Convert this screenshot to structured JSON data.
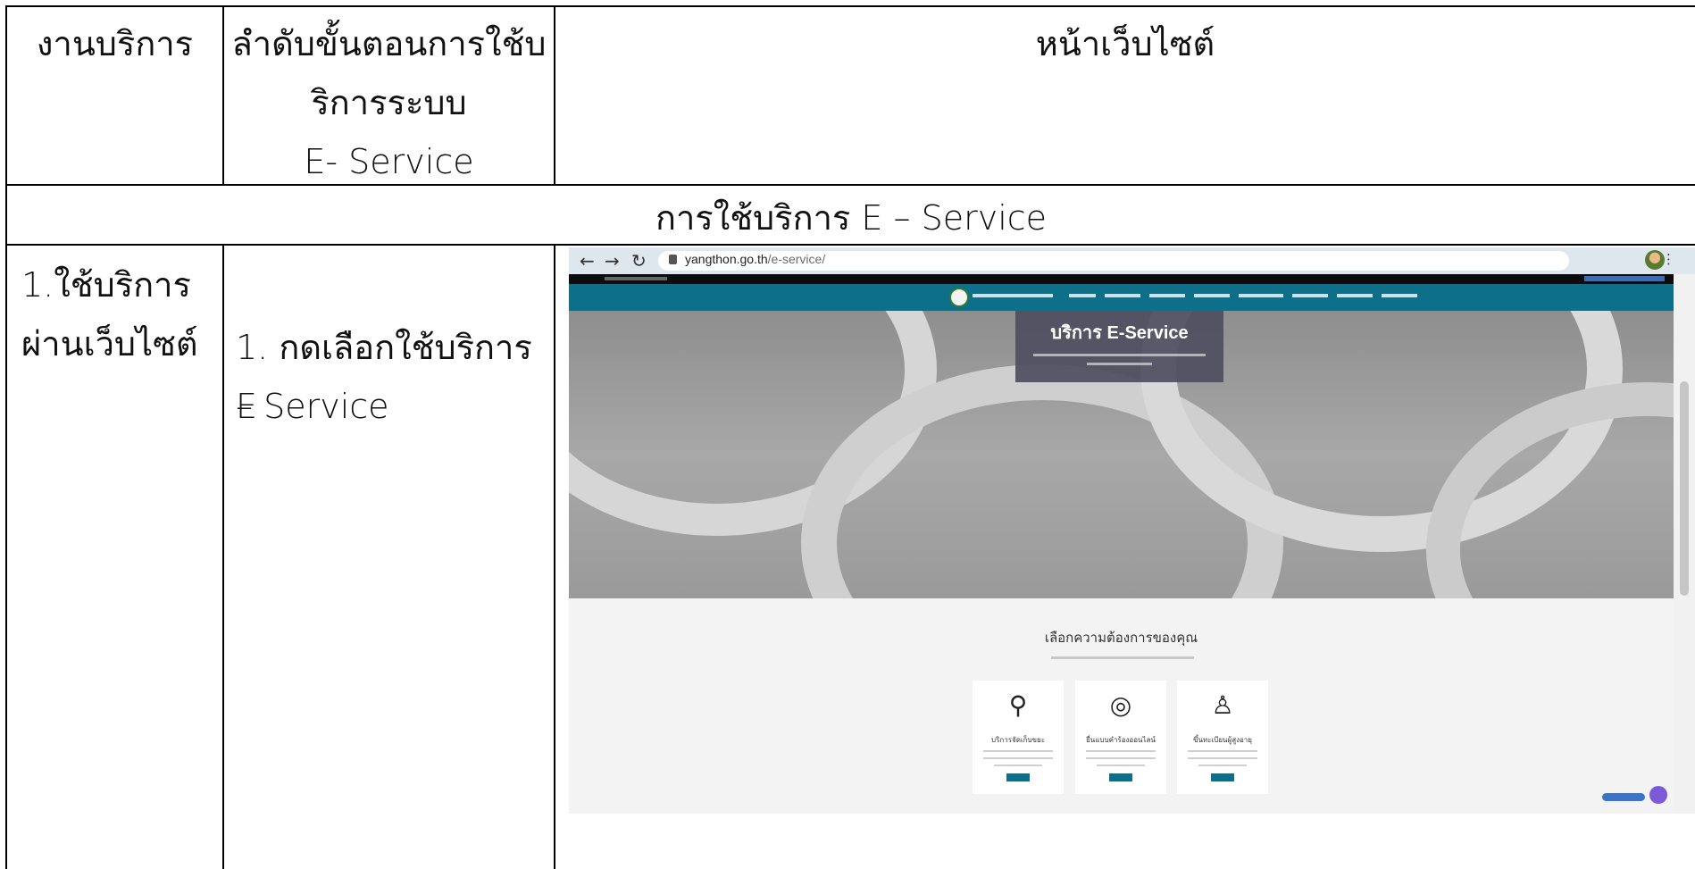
{
  "table": {
    "header": {
      "service": "งานบริการ",
      "steps": [
        "ลำดับขั้นตอนการใช้บ",
        "ริการระบบ",
        "E- Service"
      ],
      "website": "หน้าเว็บไซต์"
    },
    "section_title": "การใช้บริการ E – Service",
    "row1": {
      "service": [
        "1.ใช้บริการ",
        "ผ่านเว็บไซต์"
      ],
      "step": [
        "1. กดเลือกใช้บริการ E",
        "– Service"
      ]
    }
  },
  "screenshot": {
    "url_domain": "yangthon.go.th",
    "url_path": "/e-service/",
    "hero_title": "บริการ E-Service",
    "section_heading": "เลือกความต้องการของคุณ",
    "cards": [
      {
        "icon": "link-icon",
        "glyph": "⚲",
        "title": "บริการจัดเก็บขยะ"
      },
      {
        "icon": "target-icon",
        "glyph": "◎",
        "title": "ยื่นแบบคำร้องออนไลน์"
      },
      {
        "icon": "person-icon",
        "glyph": "♙",
        "title": "ขึ้นทะเบียนผู้สูงอายุ"
      }
    ],
    "colors": {
      "navbar": "#0e6f8a",
      "topbar": "#0c0c0c",
      "hero_box": "#4e4e60"
    }
  }
}
